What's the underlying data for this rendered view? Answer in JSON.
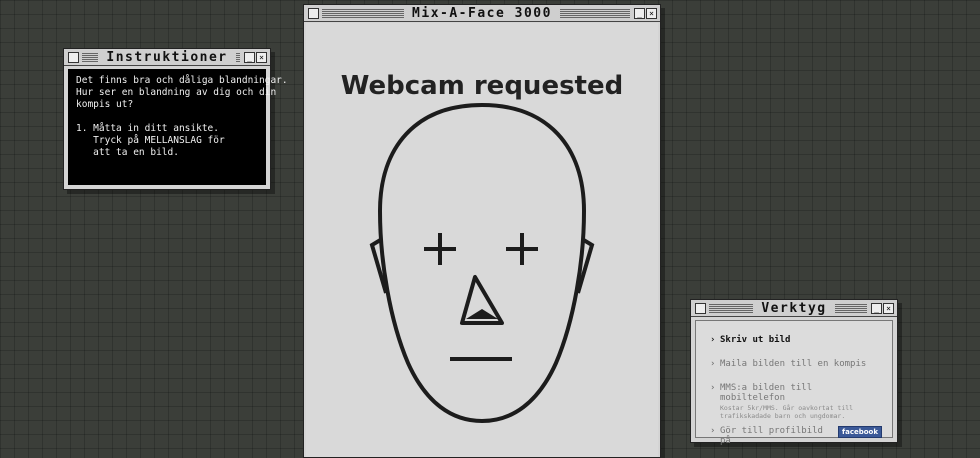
{
  "instructions_window": {
    "title": "Instruktioner",
    "text": "Det finns bra och dåliga blandningar.\nHur ser en blandning av dig och din\nkompis ut?\n\n1. Måtta in ditt ansikte.\n   Tryck på MELLANSLAG för\n   att ta en bild."
  },
  "main_window": {
    "title": "Mix-A-Face 3000",
    "headline": "Webcam requested"
  },
  "tools_window": {
    "title": "Verktyg",
    "items": [
      {
        "label": "Skriv ut bild",
        "enabled": true
      },
      {
        "label": "Maila bilden till en kompis",
        "enabled": false
      },
      {
        "label": "MMS:a bilden till mobiltelefon",
        "sub": "Kostar 5kr/MMS. Går oavkortat till\ntrafikskadade barn och ungdomar.",
        "enabled": false
      },
      {
        "label": "Gör till profilbild på",
        "badge": "facebook",
        "enabled": false
      }
    ]
  },
  "icons": {
    "close": "close-box-icon",
    "minimize": "minimize-icon",
    "maximize": "close-x-icon"
  },
  "colors": {
    "background": "#3b3e39",
    "facebook": "#3b5998"
  }
}
